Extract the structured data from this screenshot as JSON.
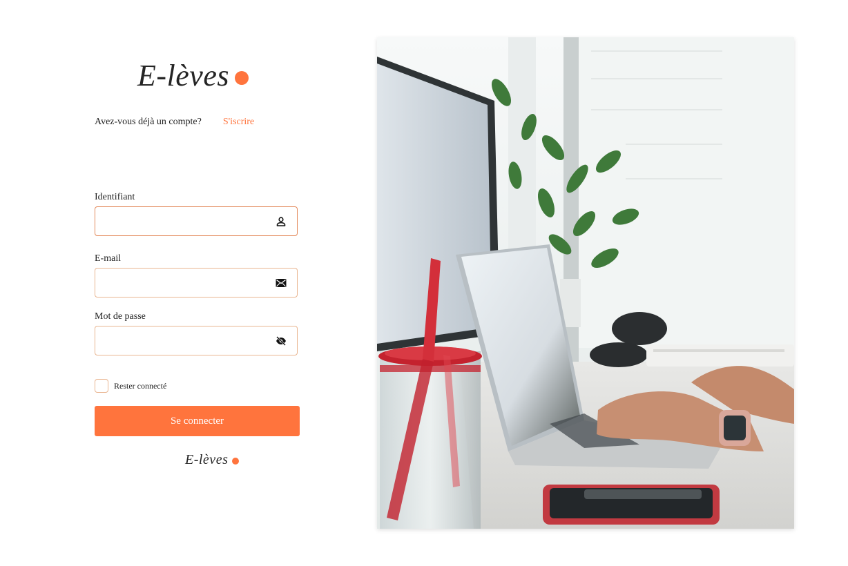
{
  "brand": {
    "name": "E-lèves",
    "accent_color": "#ff743d"
  },
  "signup": {
    "question": "Avez-vous déjà un compte?",
    "link_label": "S'iscrire"
  },
  "form": {
    "identifier": {
      "label": "Identifiant",
      "value": "",
      "icon": "user-icon"
    },
    "email": {
      "label": "E-mail",
      "value": "",
      "icon": "mail-icon"
    },
    "password": {
      "label": "Mot de passe",
      "value": "",
      "icon": "eye-off-icon"
    },
    "remember_label": "Rester connecté",
    "remember_checked": false,
    "submit_label": "Se connecter"
  },
  "footer": {
    "brand": "E-lèves"
  },
  "hero_image": {
    "subject": "person-typing-on-laptop-at-desk"
  }
}
